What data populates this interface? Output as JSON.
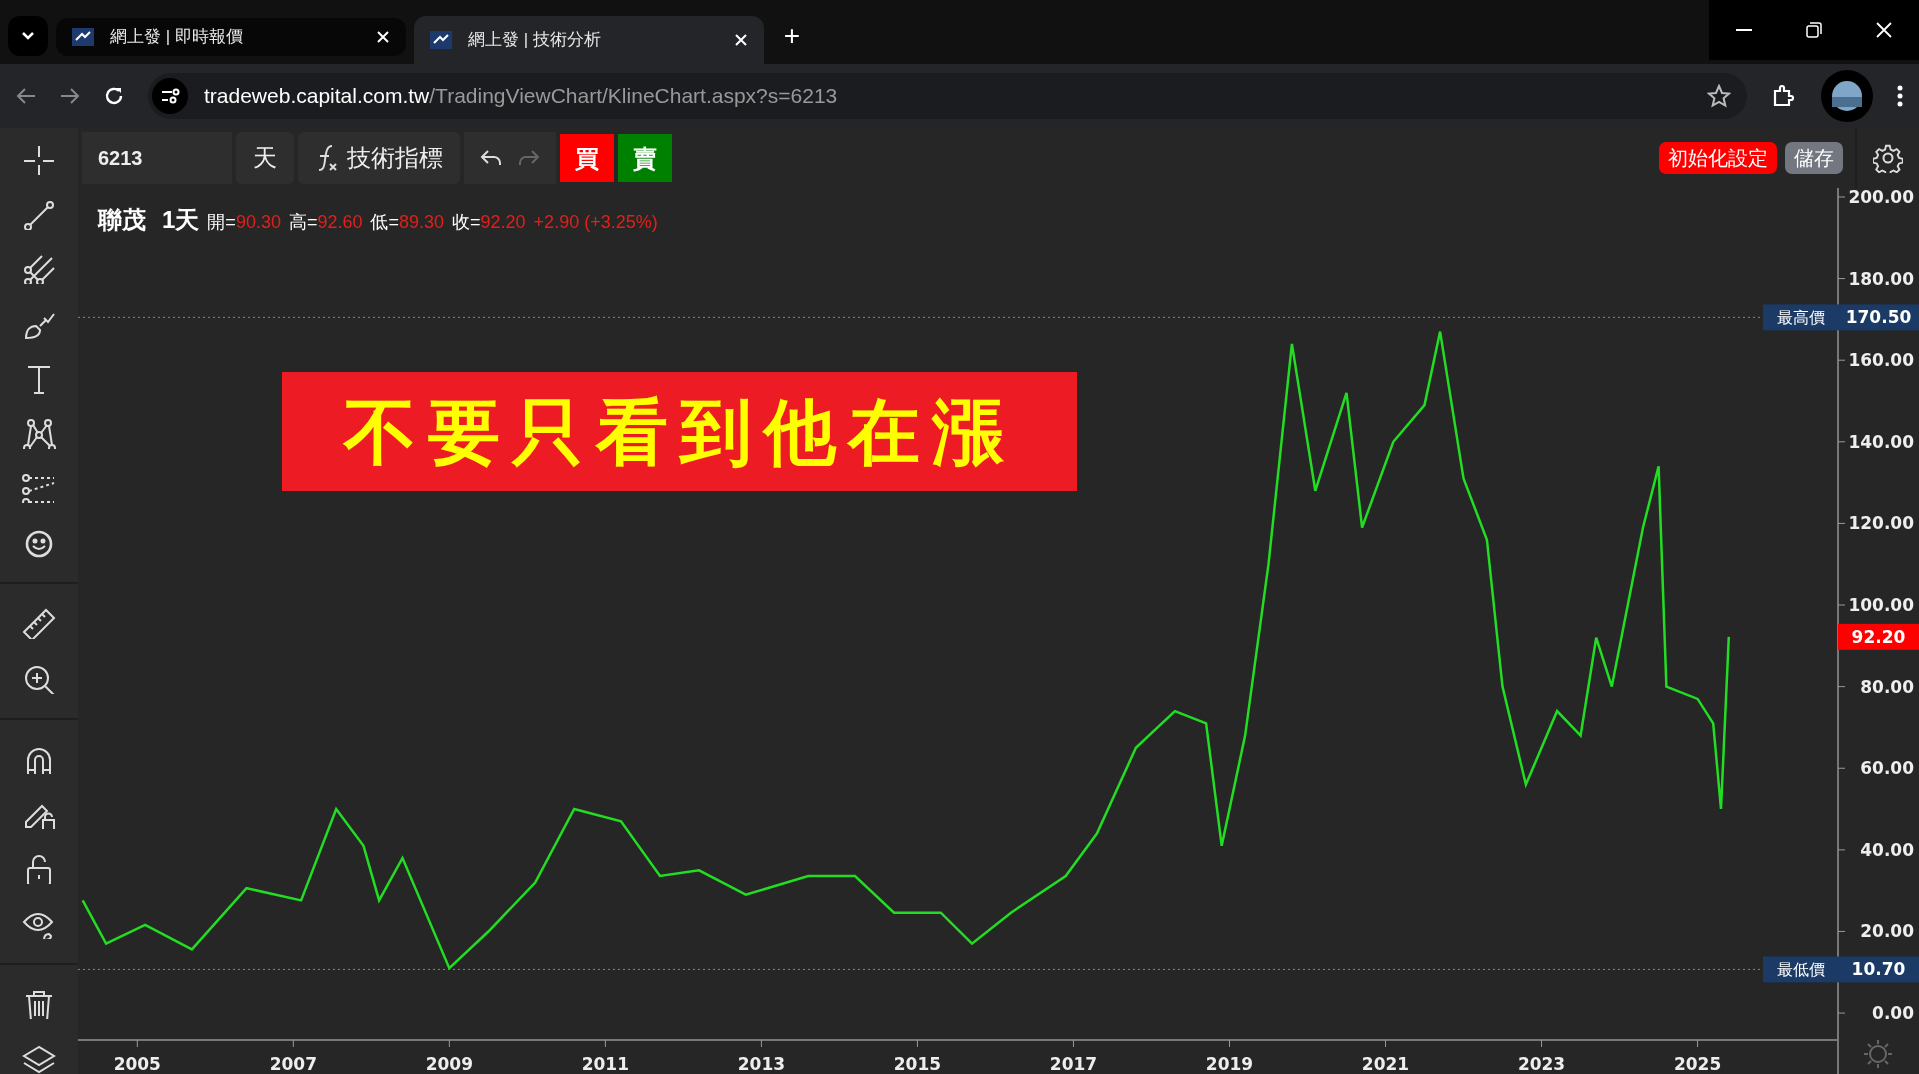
{
  "browser": {
    "tabs": [
      {
        "title": "網上發 | 即時報價",
        "selected": false
      },
      {
        "title": "網上發 | 技術分析",
        "selected": true
      }
    ],
    "new_tab": "+",
    "address": {
      "host": "tradeweb.capital.com.tw",
      "path": "/TradingViewChart/KlineChart.aspx?s=6213"
    }
  },
  "toolbar": {
    "symbol": "6213",
    "interval": "天",
    "indicators": "技術指標",
    "buy": "買",
    "sell": "賣",
    "reset": "初始化設定",
    "save": "儲存"
  },
  "legend": {
    "name": "聯茂",
    "interval": "1天",
    "items": [
      {
        "label": "開=",
        "value": "90.30"
      },
      {
        "label": "高=",
        "value": "92.60"
      },
      {
        "label": "低=",
        "value": "89.30"
      },
      {
        "label": "收=",
        "value": "92.20"
      }
    ],
    "change": "+2.90 (+3.25%)"
  },
  "banner": "不要只看到他在漲",
  "chart": {
    "chart_data": {
      "type": "line",
      "x": [
        2004.3,
        2004.6,
        2005.1,
        2005.7,
        2006.4,
        2007.1,
        2007.55,
        2007.9,
        2008.1,
        2008.4,
        2009.0,
        2009.5,
        2010.1,
        2010.6,
        2011.2,
        2011.7,
        2012.2,
        2012.8,
        2013.6,
        2014.2,
        2014.7,
        2015.3,
        2015.7,
        2016.2,
        2016.9,
        2017.3,
        2017.8,
        2018.3,
        2018.7,
        2018.9,
        2019.2,
        2019.5,
        2019.8,
        2020.1,
        2020.5,
        2020.7,
        2021.1,
        2021.5,
        2021.7,
        2022.0,
        2022.3,
        2022.5,
        2022.8,
        2023.2,
        2023.5,
        2023.7,
        2023.9,
        2024.3,
        2024.5,
        2024.6,
        2025.0,
        2025.2,
        2025.3,
        2025.4
      ],
      "xlim": [
        2004.24,
        2026.8
      ],
      "ylim": [
        -6.6,
        202.2
      ],
      "series": [
        {
          "color": "#22dd22",
          "values": [
            27.6,
            17,
            21.6,
            15.6,
            30.6,
            27.6,
            50,
            41,
            27.6,
            38,
            11,
            20,
            32,
            50,
            47,
            33.6,
            35,
            29,
            33.6,
            33.6,
            24.6,
            24.6,
            17,
            24.6,
            33.6,
            44,
            65,
            74,
            71,
            41,
            68,
            110,
            164,
            128,
            152,
            119,
            140,
            149,
            167,
            131,
            116,
            80,
            56,
            74,
            68,
            92,
            80,
            119,
            134,
            80,
            77,
            71,
            50,
            92.2
          ]
        }
      ],
      "xticks": [
        2005,
        2007,
        2009,
        2011,
        2013,
        2015,
        2017,
        2019,
        2021,
        2023,
        2025
      ],
      "yticks": [
        {
          "value": 0,
          "label": "0.00"
        },
        {
          "value": 20,
          "label": "20.00"
        },
        {
          "value": 40,
          "label": "40.00"
        },
        {
          "value": 60,
          "label": "60.00"
        },
        {
          "value": 80,
          "label": "80.00"
        },
        {
          "value": 100,
          "label": "100.00"
        },
        {
          "value": 120,
          "label": "120.00"
        },
        {
          "value": 140,
          "label": "140.00"
        },
        {
          "value": 160,
          "label": "160.00"
        },
        {
          "value": 180,
          "label": "180.00"
        },
        {
          "value": 200,
          "label": "200.00"
        }
      ],
      "ref_lines": [
        {
          "axis": "y",
          "value": 170.5,
          "label": "最高價"
        },
        {
          "axis": "y",
          "value": 10.7,
          "label": "最低價"
        }
      ]
    },
    "price_tags": [
      {
        "kind": "high",
        "value": "170.50"
      },
      {
        "kind": "last",
        "value": "92.20"
      },
      {
        "kind": "low",
        "value": "10.70"
      }
    ]
  }
}
